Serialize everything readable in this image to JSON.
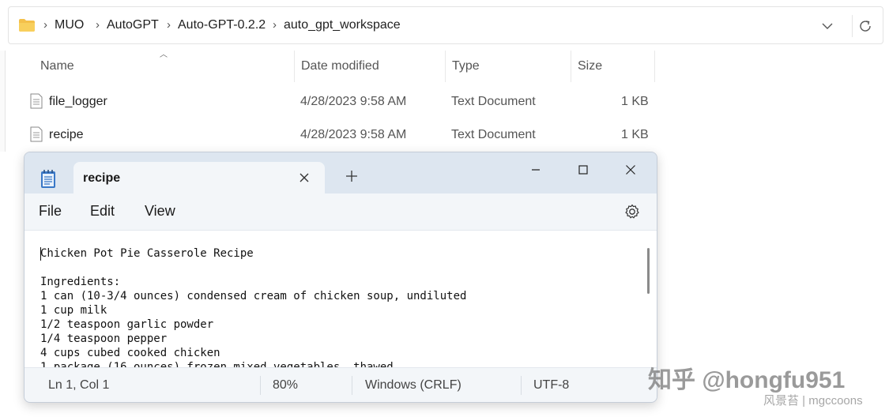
{
  "explorer": {
    "breadcrumbs": [
      "MUO",
      "AutoGPT",
      "Auto-GPT-0.2.2",
      "auto_gpt_workspace"
    ],
    "breadcrumb_separator": "›",
    "columns": {
      "name": "Name",
      "date_modified": "Date modified",
      "type": "Type",
      "size": "Size"
    },
    "files": [
      {
        "name": "file_logger",
        "date": "4/28/2023 9:58 AM",
        "type": "Text Document",
        "size": "1 KB"
      },
      {
        "name": "recipe",
        "date": "4/28/2023 9:58 AM",
        "type": "Text Document",
        "size": "1 KB"
      }
    ]
  },
  "notepad": {
    "tab_title": "recipe",
    "menu": {
      "file": "File",
      "edit": "Edit",
      "view": "View"
    },
    "content": "Chicken Pot Pie Casserole Recipe\n\nIngredients:\n1 can (10-3/4 ounces) condensed cream of chicken soup, undiluted\n1 cup milk\n1/2 teaspoon garlic powder\n1/4 teaspoon pepper\n4 cups cubed cooked chicken\n1 package (16 ounces) frozen mixed vegetables, thawed",
    "status": {
      "position": "Ln 1, Col 1",
      "zoom": "80%",
      "line_ending": "Windows (CRLF)",
      "encoding": "UTF-8"
    }
  },
  "watermark": {
    "line1": "知乎 @hongfu951",
    "line2": "风景苔 | mgccoons"
  },
  "icons": {
    "folder": "folder-icon",
    "chevron_down": "chevron-down-icon",
    "refresh": "refresh-icon",
    "file": "text-file-icon",
    "notepad": "notepad-app-icon",
    "close": "close-icon",
    "plus": "new-tab-icon",
    "minimize": "minimize-icon",
    "maximize": "maximize-icon",
    "settings": "gear-icon"
  },
  "colors": {
    "folder": "#f4c04a",
    "titlebar": "#dde6f0",
    "chrome": "#f3f6f9",
    "notepad_icon": "#3a78c7"
  }
}
